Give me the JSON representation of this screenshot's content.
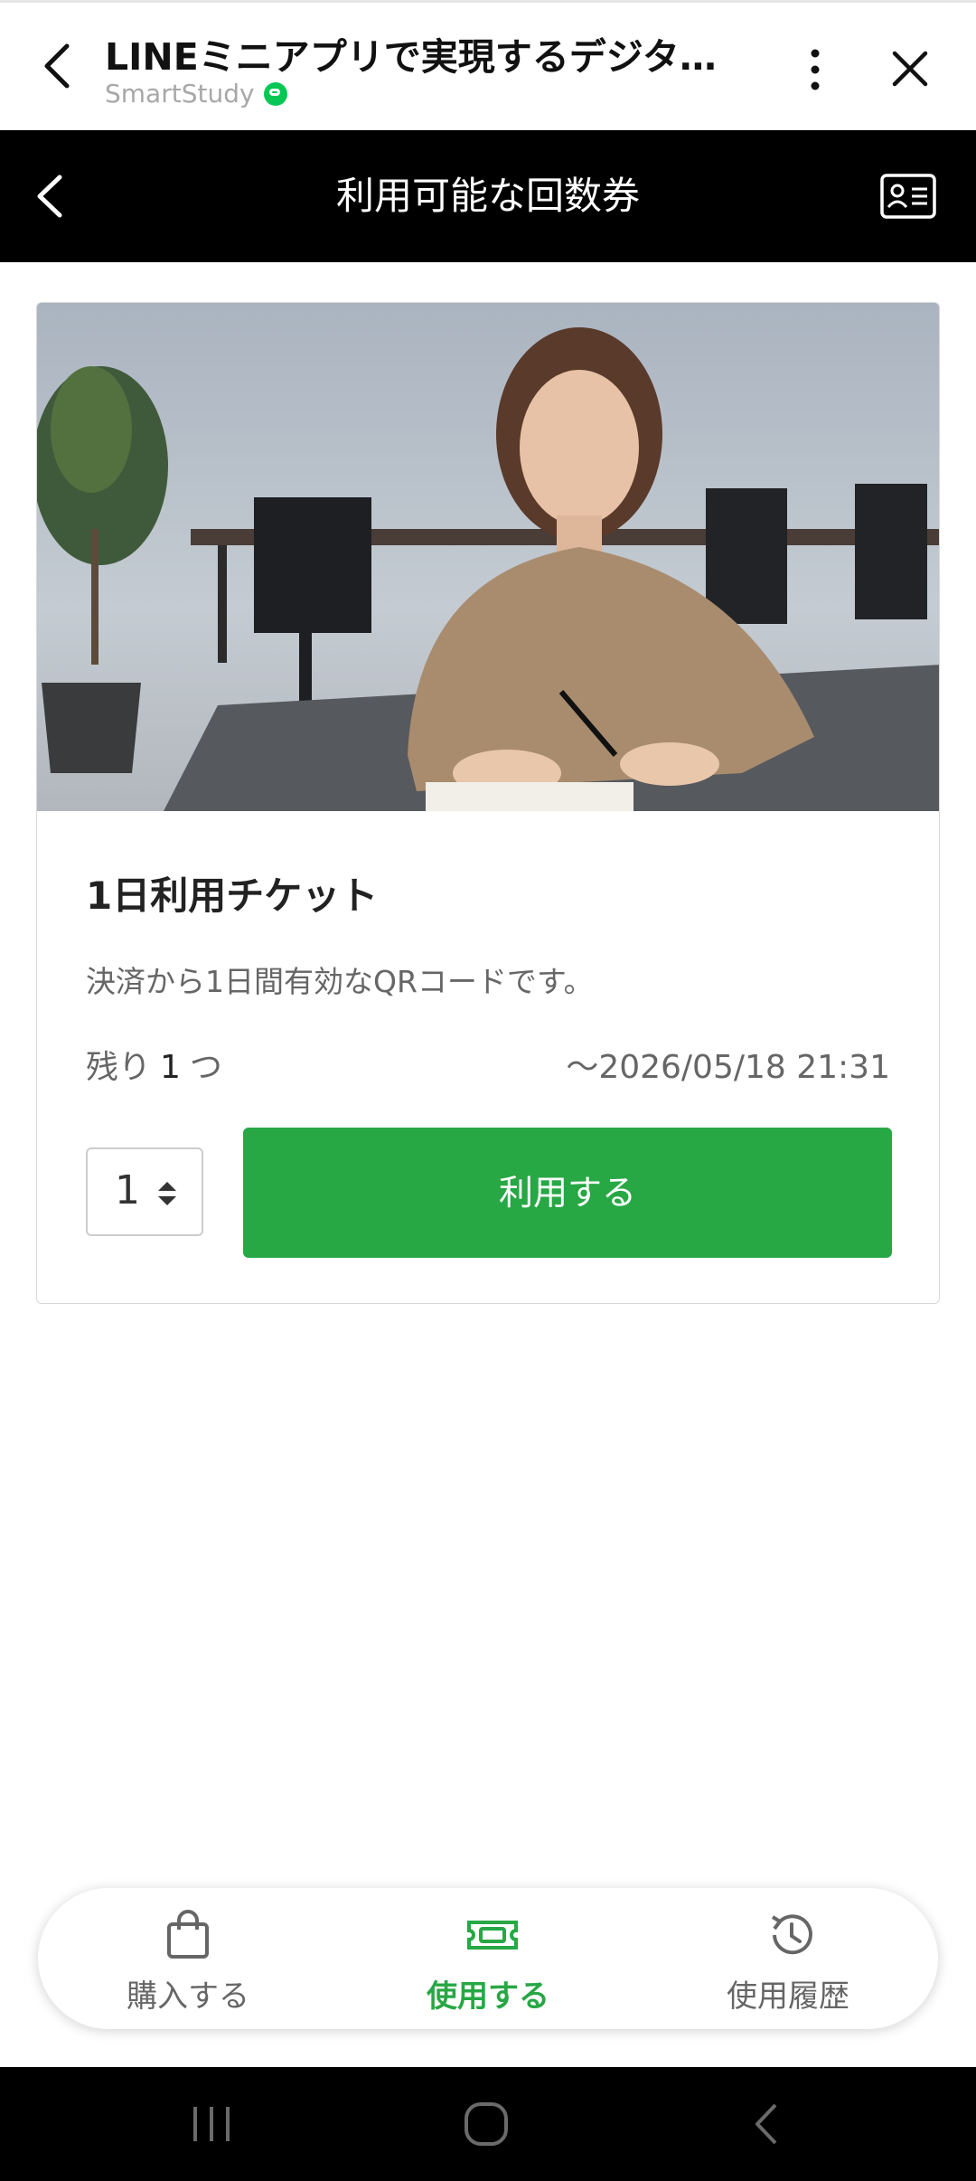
{
  "app_header": {
    "title": "LINEミニアプリで実現するデジタル…",
    "subtitle": "SmartStudy"
  },
  "nav": {
    "title": "利用可能な回数券"
  },
  "ticket": {
    "title": "1日利用チケット",
    "description": "決済から1日間有効なQRコードです。",
    "remaining_label": "残り",
    "remaining_count": "1",
    "remaining_unit": "つ",
    "expiry": "〜2026/05/18 21:31",
    "quantity": "1",
    "use_button": "利用する"
  },
  "tabs": [
    {
      "label": "購入する",
      "icon": "shopping-bag-icon",
      "active": false
    },
    {
      "label": "使用する",
      "icon": "ticket-icon",
      "active": true
    },
    {
      "label": "使用履歴",
      "icon": "history-icon",
      "active": false
    }
  ],
  "colors": {
    "accent": "#28a745",
    "verified": "#06c755",
    "nav_bg": "#000000"
  }
}
